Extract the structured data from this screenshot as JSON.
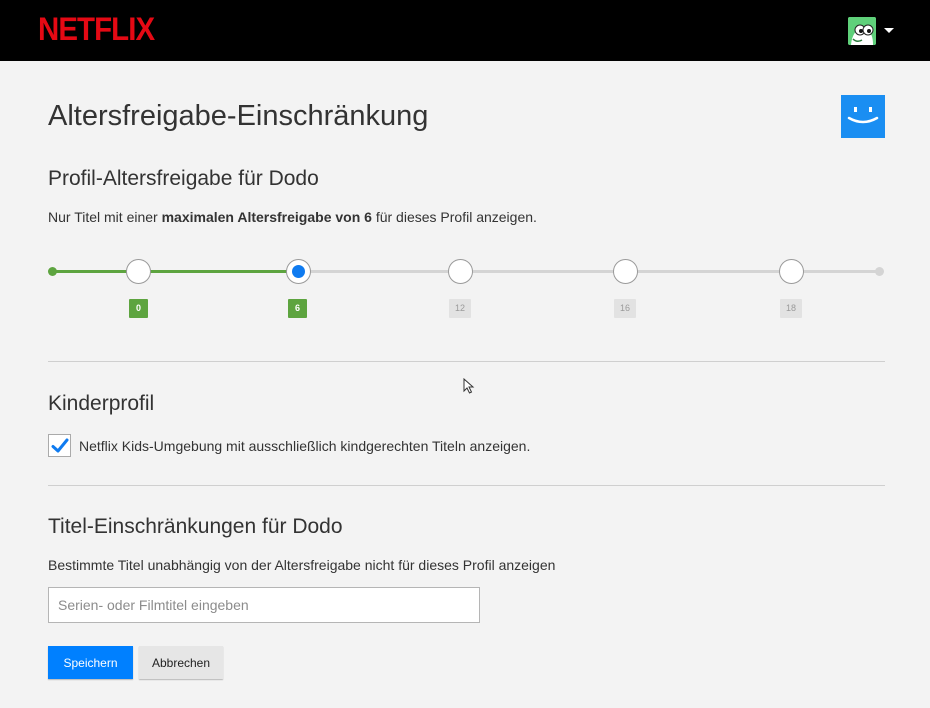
{
  "header": {
    "logo_text": "NETFLIX",
    "avatar_icon": "green-character-avatar-icon",
    "menu_icon": "caret-down-icon",
    "brand_color": "#e50914"
  },
  "page": {
    "title": "Altersfreigabe-Einschränkung",
    "profile_icon": "blue-smiley-profile-icon"
  },
  "maturity": {
    "section_title": "Profil-Altersfreigabe für Dodo",
    "desc_prefix": "Nur Titel mit einer ",
    "desc_bold": "maximalen Altersfreigabe von 6",
    "desc_suffix": " für dieses Profil anzeigen.",
    "levels": [
      "0",
      "6",
      "12",
      "16",
      "18"
    ],
    "selected_level": "6",
    "active_color": "#5da43f",
    "selected_color": "#0f7bf0"
  },
  "kids": {
    "section_title": "Kinderprofil",
    "checkbox_checked": true,
    "checkbox_label": "Netflix Kids-Umgebung mit ausschließlich kindgerechten Titeln anzeigen."
  },
  "title_restrictions": {
    "section_title": "Titel-Einschränkungen für Dodo",
    "description": "Bestimmte Titel unabhängig von der Altersfreigabe nicht für dieses Profil anzeigen",
    "search_value": "",
    "search_placeholder": "Serien- oder Filmtitel eingeben"
  },
  "actions": {
    "save_label": "Speichern",
    "cancel_label": "Abbrechen",
    "save_color": "#0080ff"
  }
}
